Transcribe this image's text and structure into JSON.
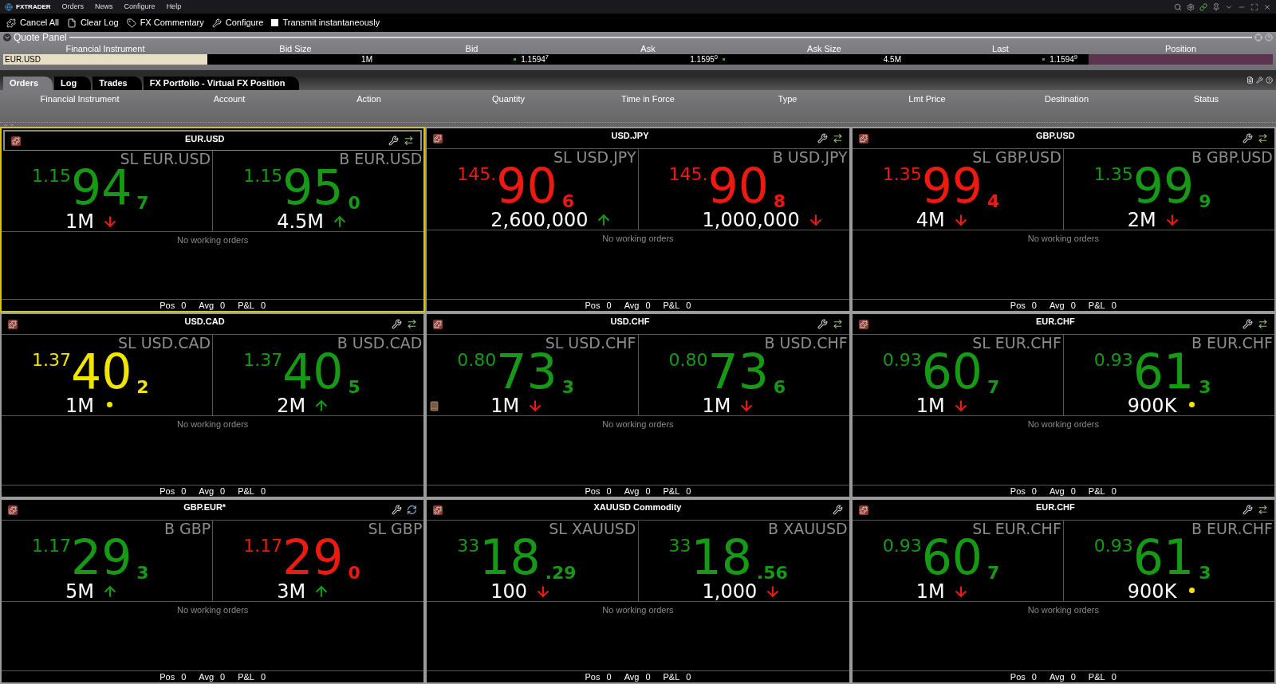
{
  "app": {
    "name": "FXTRADER"
  },
  "menu": [
    "Orders",
    "News",
    "Configure",
    "Help"
  ],
  "toolbar": {
    "buttons": [
      {
        "kind": "cancel",
        "label": "Cancel All"
      },
      {
        "kind": "clear",
        "label": "Clear Log"
      },
      {
        "kind": "commentary",
        "label": "FX Commentary"
      },
      {
        "kind": "configure",
        "label": "Configure"
      }
    ],
    "transmit": {
      "label": "Transmit instantaneously",
      "checked": false
    }
  },
  "quote_panel": {
    "title": "Quote Panel",
    "columns": [
      "Financial Instrument",
      "Bid Size",
      "Bid",
      "Ask",
      "Ask Size",
      "Last",
      "Position"
    ],
    "row": [
      {
        "kind": "instrument",
        "value": "EUR.USD"
      },
      {
        "kind": "size",
        "value": "1M"
      },
      {
        "kind": "bid",
        "value": "1.1594$^{7}$"
      },
      {
        "kind": "ask",
        "value": "1.1595$^{0}$"
      },
      {
        "kind": "size",
        "value": "4.5M"
      },
      {
        "kind": "last",
        "value": "1.1594$^{9}$"
      },
      {
        "kind": "position"
      }
    ]
  },
  "tabs": [
    {
      "label": "Orders",
      "selected": true
    },
    {
      "label": "Log",
      "selected": false
    },
    {
      "label": "Trades",
      "selected": false
    },
    {
      "label": "FX Portfolio - Virtual FX Position",
      "selected": false
    }
  ],
  "order_columns": [
    "Financial Instrument",
    "Account",
    "Action",
    "Quantity",
    "Time in Force",
    "Type",
    "Lmt Price",
    "Destination",
    "Status"
  ],
  "tiles": [
    {
      "title": "EUR.USD",
      "selected": true,
      "tools": [
        {
          "kind": "wrench"
        },
        {
          "kind": "swap"
        }
      ],
      "note": false,
      "orders": "No working orders",
      "stats": [
        {
          "label": "Pos",
          "value": "0"
        },
        {
          "label": "Avg",
          "value": "0"
        },
        {
          "label": "P&L",
          "value": "0"
        }
      ],
      "sides": [
        {
          "label": "SL EUR.USD",
          "prefix": "1.15",
          "big": "94",
          "pip": "7",
          "size": "1M",
          "trend": {
            "kind": "down"
          },
          "color": "#169a16"
        },
        {
          "label": "B EUR.USD",
          "prefix": "1.15",
          "big": "95",
          "pip": "0",
          "size": "4.5M",
          "trend": {
            "kind": "up"
          },
          "color": "#169a16"
        }
      ]
    },
    {
      "title": "USD.JPY",
      "selected": false,
      "tools": [
        {
          "kind": "wrench"
        },
        {
          "kind": "swap"
        }
      ],
      "note": false,
      "orders": "No working orders",
      "stats": [
        {
          "label": "Pos",
          "value": "0"
        },
        {
          "label": "Avg",
          "value": "0"
        },
        {
          "label": "P&L",
          "value": "0"
        }
      ],
      "sides": [
        {
          "label": "SL USD.JPY",
          "prefix": "145.",
          "big": "90",
          "pip": "6",
          "size": "2,600,000",
          "trend": {
            "kind": "up"
          },
          "color": "#ee1a10"
        },
        {
          "label": "B USD.JPY",
          "prefix": "145.",
          "big": "90",
          "pip": "8",
          "size": "1,000,000",
          "trend": {
            "kind": "down"
          },
          "color": "#ee1a10"
        }
      ]
    },
    {
      "title": "GBP.USD",
      "selected": false,
      "tools": [
        {
          "kind": "wrench"
        },
        {
          "kind": "swap"
        }
      ],
      "note": false,
      "orders": "No working orders",
      "stats": [
        {
          "label": "Pos",
          "value": "0"
        },
        {
          "label": "Avg",
          "value": "0"
        },
        {
          "label": "P&L",
          "value": "0"
        }
      ],
      "sides": [
        {
          "label": "SL GBP.USD",
          "prefix": "1.35",
          "big": "99",
          "pip": "4",
          "size": "4M",
          "trend": {
            "kind": "down"
          },
          "color": "#ee1a10"
        },
        {
          "label": "B GBP.USD",
          "prefix": "1.35",
          "big": "99",
          "pip": "9",
          "size": "2M",
          "trend": {
            "kind": "down"
          },
          "color": "#169a16"
        }
      ]
    },
    {
      "title": "USD.CAD",
      "selected": false,
      "tools": [
        {
          "kind": "wrench"
        },
        {
          "kind": "swap"
        }
      ],
      "note": false,
      "orders": "No working orders",
      "stats": [
        {
          "label": "Pos",
          "value": "0"
        },
        {
          "label": "Avg",
          "value": "0"
        },
        {
          "label": "P&L",
          "value": "0"
        }
      ],
      "sides": [
        {
          "label": "SL USD.CAD",
          "prefix": "1.37",
          "big": "40",
          "pip": "2",
          "size": "1M",
          "trend": {
            "kind": "flat"
          },
          "color": "#f0e400"
        },
        {
          "label": "B USD.CAD",
          "prefix": "1.37",
          "big": "40",
          "pip": "5",
          "size": "2M",
          "trend": {
            "kind": "up"
          },
          "color": "#169a16"
        }
      ]
    },
    {
      "title": "USD.CHF",
      "selected": false,
      "tools": [
        {
          "kind": "wrench"
        },
        {
          "kind": "swap"
        }
      ],
      "note": true,
      "orders": "No working orders",
      "stats": [
        {
          "label": "Pos",
          "value": "0"
        },
        {
          "label": "Avg",
          "value": "0"
        },
        {
          "label": "P&L",
          "value": "0"
        }
      ],
      "sides": [
        {
          "label": "SL USD.CHF",
          "prefix": "0.80",
          "big": "73",
          "pip": "3",
          "size": "1M",
          "trend": {
            "kind": "down"
          },
          "color": "#169a16"
        },
        {
          "label": "B USD.CHF",
          "prefix": "0.80",
          "big": "73",
          "pip": "6",
          "size": "1M",
          "trend": {
            "kind": "down"
          },
          "color": "#169a16"
        }
      ]
    },
    {
      "title": "EUR.CHF",
      "selected": false,
      "tools": [
        {
          "kind": "wrench"
        },
        {
          "kind": "swap"
        }
      ],
      "note": false,
      "orders": "No working orders",
      "stats": [
        {
          "label": "Pos",
          "value": "0"
        },
        {
          "label": "Avg",
          "value": "0"
        },
        {
          "label": "P&L",
          "value": "0"
        }
      ],
      "sides": [
        {
          "label": "SL EUR.CHF",
          "prefix": "0.93",
          "big": "60",
          "pip": "7",
          "size": "1M",
          "trend": {
            "kind": "down"
          },
          "color": "#169a16"
        },
        {
          "label": "B EUR.CHF",
          "prefix": "0.93",
          "big": "61",
          "pip": "3",
          "size": "900K",
          "trend": {
            "kind": "flat"
          },
          "color": "#169a16"
        }
      ]
    },
    {
      "title": "GBP.EUR*",
      "selected": false,
      "tools": [
        {
          "kind": "wrench"
        },
        {
          "kind": "refresh"
        }
      ],
      "note": false,
      "orders": "No working orders",
      "stats": [
        {
          "label": "Pos",
          "value": "0"
        },
        {
          "label": "Avg",
          "value": "0"
        },
        {
          "label": "P&L",
          "value": "0"
        }
      ],
      "sides": [
        {
          "label": "B GBP",
          "prefix": "1.17",
          "big": "29",
          "pip": "3",
          "size": "5M",
          "trend": {
            "kind": "up"
          },
          "color": "#169a16"
        },
        {
          "label": "SL GBP",
          "prefix": "1.17",
          "big": "29",
          "pip": "0",
          "size": "3M",
          "trend": {
            "kind": "up"
          },
          "color": "#ee1a10"
        }
      ]
    },
    {
      "title": "XAUUSD Commodity",
      "selected": false,
      "tools": [
        {
          "kind": "wrench"
        }
      ],
      "note": false,
      "orders": "No working orders",
      "stats": [
        {
          "label": "Pos",
          "value": "0"
        },
        {
          "label": "Avg",
          "value": "0"
        },
        {
          "label": "P&L",
          "value": "0"
        }
      ],
      "sides": [
        {
          "label": "SL XAUUSD",
          "prefix": "33",
          "big": "18",
          "pip": ".29",
          "size": "100",
          "trend": {
            "kind": "down"
          },
          "color": "#169a16"
        },
        {
          "label": "B XAUUSD",
          "prefix": "33",
          "big": "18",
          "pip": ".56",
          "size": "1,000",
          "trend": {
            "kind": "down"
          },
          "color": "#169a16"
        }
      ]
    },
    {
      "title": "EUR.CHF",
      "selected": false,
      "tools": [
        {
          "kind": "wrench"
        },
        {
          "kind": "swap"
        }
      ],
      "note": false,
      "orders": "No working orders",
      "stats": [
        {
          "label": "Pos",
          "value": "0"
        },
        {
          "label": "Avg",
          "value": "0"
        },
        {
          "label": "P&L",
          "value": "0"
        }
      ],
      "sides": [
        {
          "label": "SL EUR.CHF",
          "prefix": "0.93",
          "big": "60",
          "pip": "7",
          "size": "1M",
          "trend": {
            "kind": "down"
          },
          "color": "#169a16"
        },
        {
          "label": "B EUR.CHF",
          "prefix": "0.93",
          "big": "61",
          "pip": "3",
          "size": "900K",
          "trend": {
            "kind": "flat"
          },
          "color": "#169a16"
        }
      ]
    }
  ]
}
